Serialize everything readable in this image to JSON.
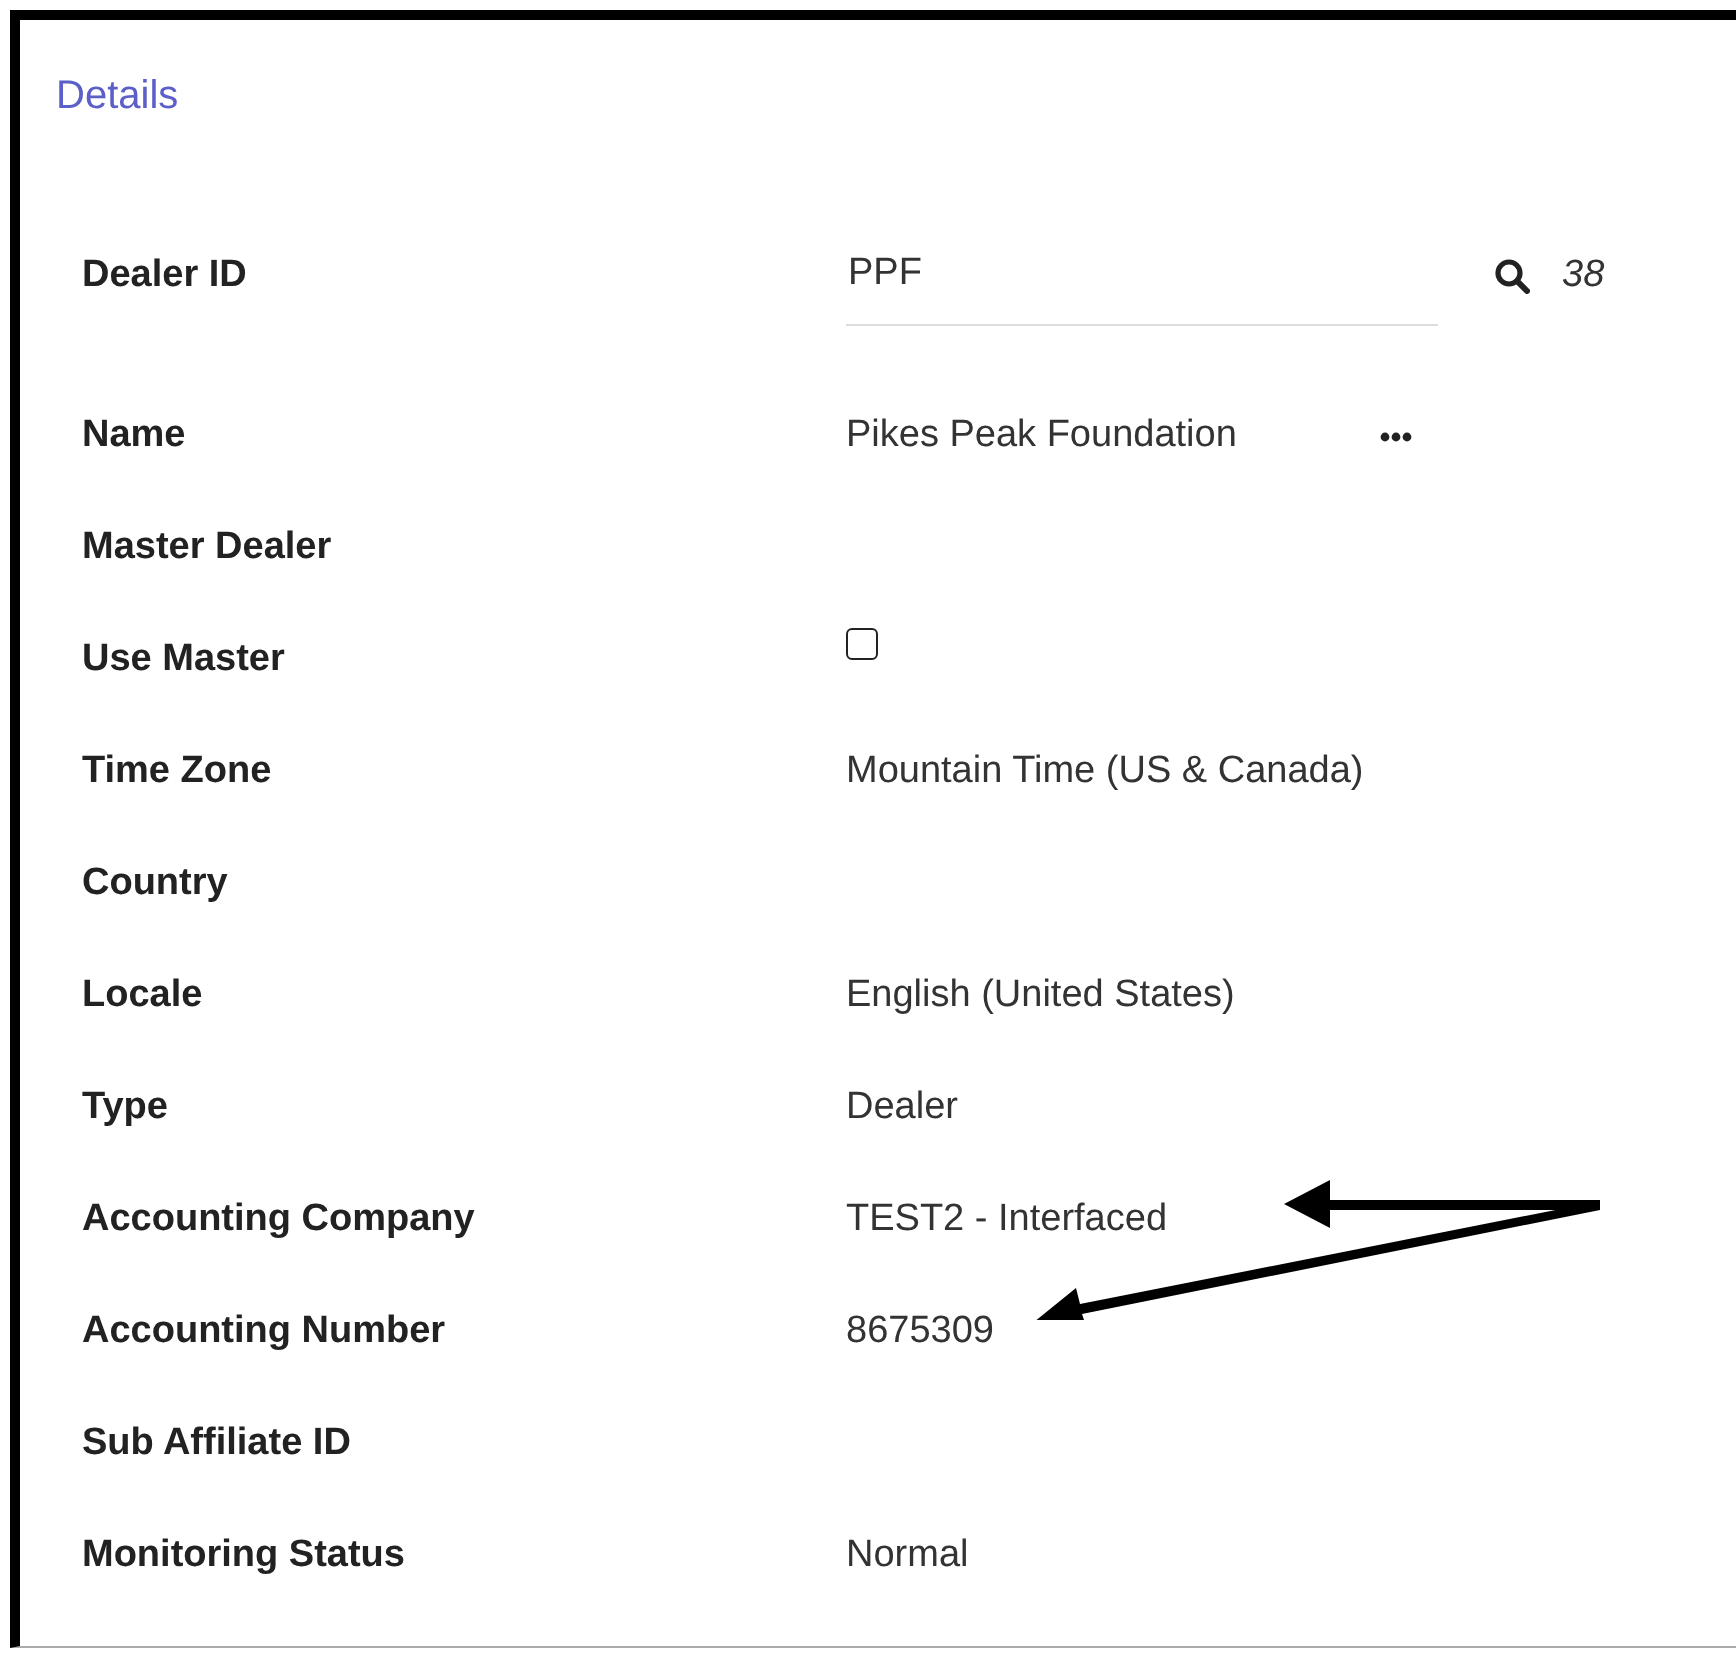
{
  "section_title": "Details",
  "rows": [
    {
      "kind": "lookup",
      "label": "Dealer ID",
      "value": "PPF",
      "count": "38"
    },
    {
      "kind": "menu",
      "label": "Name",
      "value": "Pikes Peak Foundation"
    },
    {
      "kind": "text",
      "label": "Master Dealer"
    },
    {
      "kind": "checkbox",
      "label": "Use Master",
      "checked": false
    },
    {
      "kind": "text",
      "label": "Time Zone",
      "value": "Mountain Time (US & Canada)"
    },
    {
      "kind": "text",
      "label": "Country"
    },
    {
      "kind": "text",
      "label": "Locale",
      "value": "English (United States)"
    },
    {
      "kind": "text",
      "label": "Type",
      "value": "Dealer"
    },
    {
      "kind": "text",
      "label": "Accounting Company",
      "value": "TEST2 - Interfaced"
    },
    {
      "kind": "text",
      "label": "Accounting Number",
      "value": "8675309"
    },
    {
      "kind": "text",
      "label": "Sub Affiliate ID"
    },
    {
      "kind": "text",
      "label": "Monitoring Status",
      "value": "Normal"
    }
  ]
}
